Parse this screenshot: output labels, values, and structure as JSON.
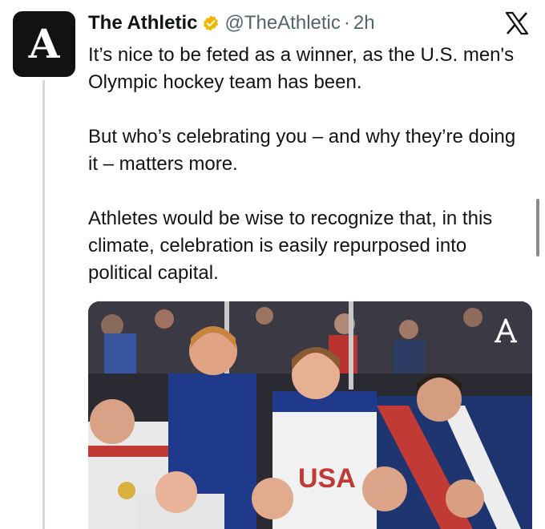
{
  "tweet": {
    "author_name": "The Athletic",
    "handle": "@TheAthletic",
    "separator": "·",
    "time": "2h",
    "avatar_letter": "A",
    "paragraphs": [
      "It’s nice to be feted as a winner, as the U.S. men's Olympic hockey team has been.",
      "But who’s celebrating you – and why they’re doing it – matters more.",
      "Athletes would be wise to recognize that, in this climate, celebration is easily repurposed into political capital."
    ]
  },
  "media": {
    "jersey_letters": "USA",
    "watermark_letter": "A"
  },
  "colors": {
    "verified_badge": "#f4b400",
    "name_text": "#0f1419",
    "secondary_text": "#536471",
    "thread_line": "#cfd9de"
  },
  "icons": [
    "verified-badge-icon",
    "x-logo-icon",
    "athletic-watermark-icon"
  ]
}
